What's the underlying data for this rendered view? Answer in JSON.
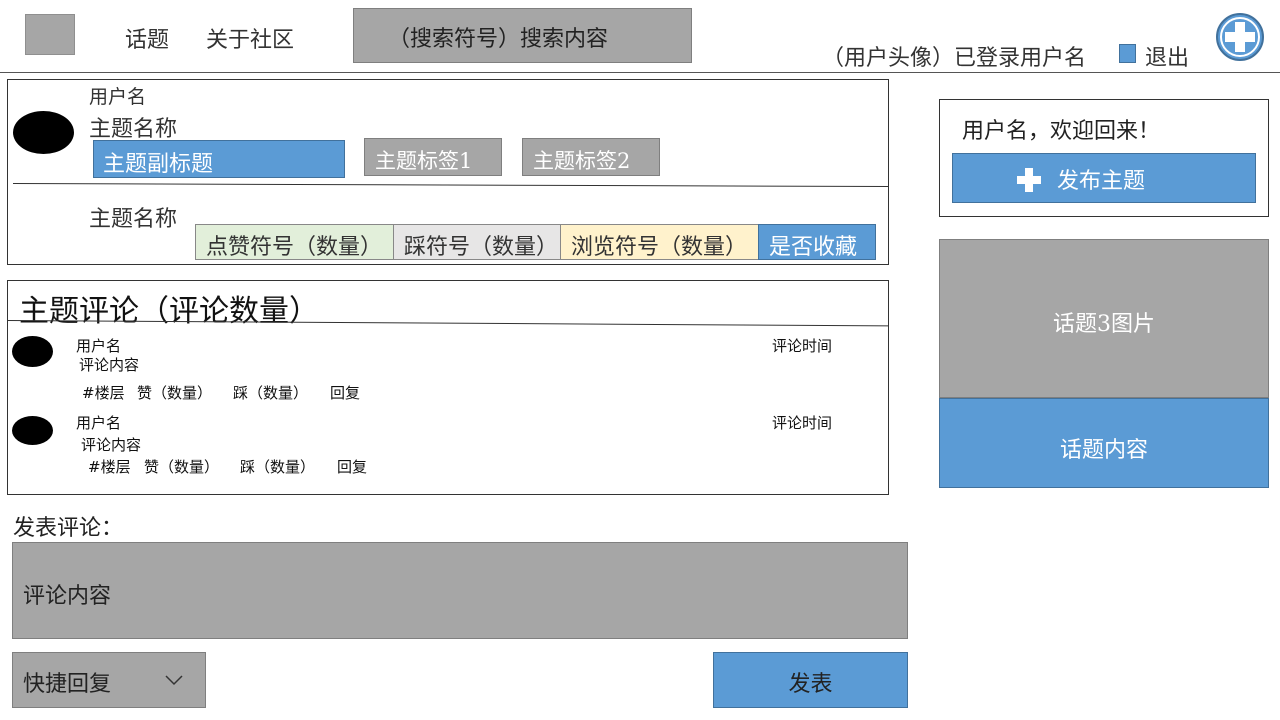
{
  "header": {
    "nav": [
      "话题",
      "关于社区"
    ],
    "search_placeholder": "（搜索符号）搜索内容",
    "user_label": "（用户头像）已登录用户名",
    "logout": "退出"
  },
  "topic": {
    "username": "用户名",
    "name": "主题名称",
    "subtitle": "主题副标题",
    "tags": [
      "主题标签1",
      "主题标签2"
    ],
    "name2": "主题名称",
    "stats": [
      "点赞符号（数量）",
      "踩符号（数量）",
      "浏览符号（数量）",
      "是否收藏"
    ]
  },
  "comments": {
    "title": "主题评论（评论数量）",
    "items": [
      {
        "username": "用户名",
        "time": "评论时间",
        "content": "评论内容",
        "floor": "#楼层",
        "like": "赞（数量）",
        "dislike": "踩（数量）",
        "reply": "回复"
      },
      {
        "username": "用户名",
        "time": "评论时间",
        "content": "评论内容",
        "floor": "#楼层",
        "like": "赞（数量）",
        "dislike": "踩（数量）",
        "reply": "回复"
      }
    ]
  },
  "post": {
    "label": "发表评论：",
    "input_placeholder": "评论内容",
    "quick_reply": "快捷回复",
    "submit": "发表"
  },
  "sidebar": {
    "welcome": "用户名，欢迎回来！",
    "new_topic": "发布主题",
    "topic_image": "话题3图片",
    "topic_content": "话题内容"
  },
  "colors": {
    "blue": "#5b9bd5",
    "gray": "#a6a6a6",
    "like_bg": "#e2efda",
    "dislike_bg": "#e7e6e6",
    "view_bg": "#fff2cc"
  },
  "icons": [
    "logo",
    "plus-circle-icon",
    "chevron-down-icon",
    "plus-icon"
  ]
}
